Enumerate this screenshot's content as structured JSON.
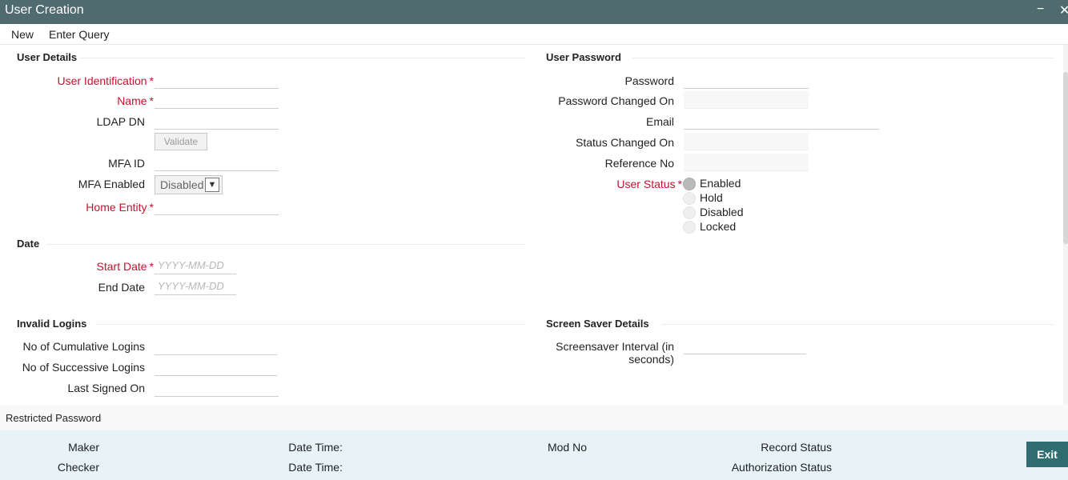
{
  "window": {
    "title": "User Creation",
    "minimize": "−",
    "close": "✕"
  },
  "menu": {
    "new": "New",
    "enter_query": "Enter Query"
  },
  "user_details": {
    "title": "User Details",
    "user_identification": "User Identification",
    "name": "Name",
    "ldap_dn": "LDAP DN",
    "validate": "Validate",
    "mfa_id": "MFA ID",
    "mfa_enabled": "MFA Enabled",
    "mfa_enabled_value": "Disabled",
    "home_entity": "Home Entity"
  },
  "date": {
    "title": "Date",
    "start_date": "Start Date",
    "end_date": "End Date",
    "placeholder": "YYYY-MM-DD"
  },
  "invalid_logins": {
    "title": "Invalid Logins",
    "cumulative": "No of Cumulative Logins",
    "successive": "No of Successive Logins",
    "last_signed_on": "Last Signed On"
  },
  "user_password": {
    "title": "User Password",
    "password": "Password",
    "password_changed_on": "Password Changed On",
    "email": "Email",
    "status_changed_on": "Status Changed On",
    "reference_no": "Reference No",
    "user_status": "User Status",
    "status_options": [
      "Enabled",
      "Hold",
      "Disabled",
      "Locked"
    ],
    "selected_status": "Enabled"
  },
  "screen_saver": {
    "title": "Screen Saver Details",
    "interval_line1": "Screensaver Interval (in",
    "interval_line2": "seconds)"
  },
  "restricted_password": "Restricted Password",
  "footer": {
    "maker": "Maker",
    "checker": "Checker",
    "date_time": "Date Time:",
    "mod_no": "Mod No",
    "record_status": "Record Status",
    "authorization_status": "Authorization Status",
    "exit": "Exit"
  },
  "required_mark": "*",
  "colors": {
    "titlebar": "#4f6b70",
    "required": "#c8102e",
    "footer": "#e7f3f6",
    "exit_button": "#2f6d73"
  }
}
